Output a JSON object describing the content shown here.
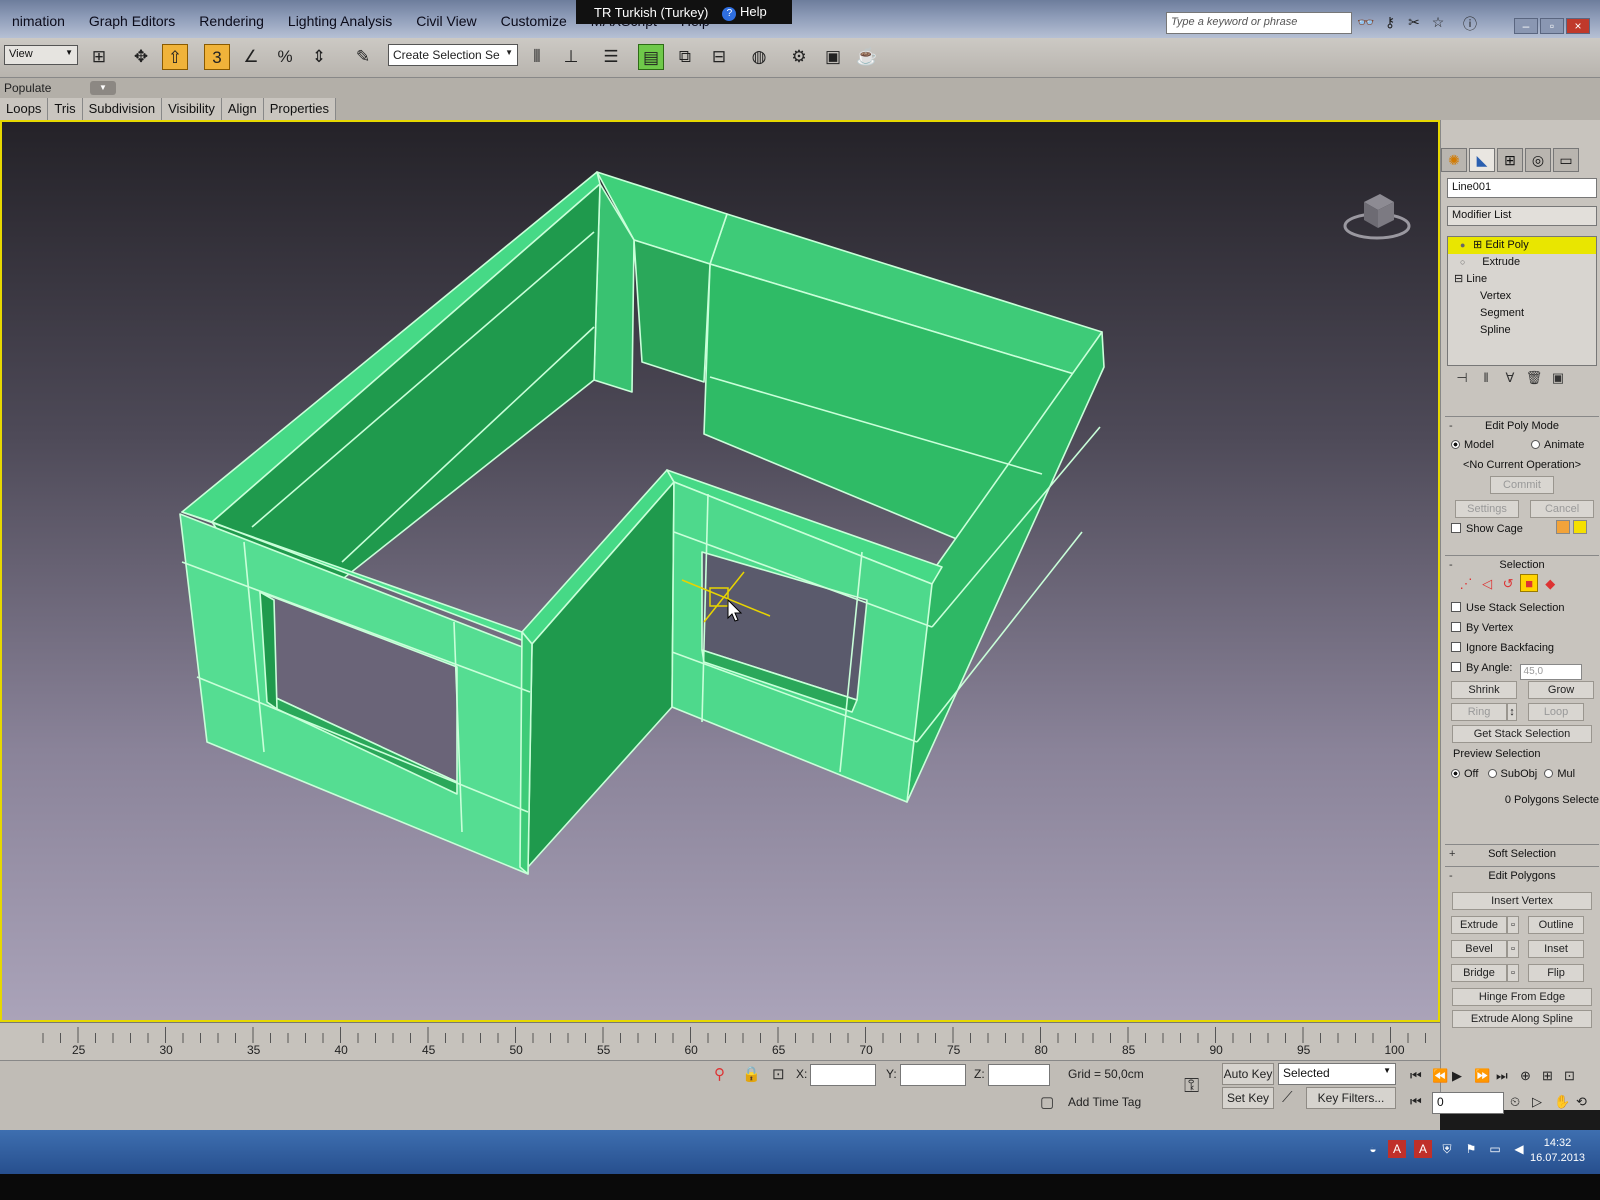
{
  "menu": {
    "items": [
      "nimation",
      "Graph Editors",
      "Rendering",
      "Lighting Analysis",
      "Civil View",
      "Customize",
      "MAXScript",
      "Help"
    ],
    "language_popup": "TR Turkish (Turkey)",
    "language_help": "Help",
    "search_placeholder": "Type a keyword or phrase"
  },
  "toolbar": {
    "view_dropdown": "View",
    "selection_set": "Create Selection Se",
    "snap_label": "3"
  },
  "ribbon": {
    "populate": "Populate",
    "tabs": [
      "Loops",
      "Tris",
      "Subdivision",
      "Visibility",
      "Align",
      "Properties"
    ]
  },
  "command_panel": {
    "object_name": "Line001",
    "modifier_list": "Modifier List",
    "stack": [
      "Edit Poly",
      "Extrude",
      "Line",
      "Vertex",
      "Segment",
      "Spline"
    ],
    "edit_poly_mode": {
      "title": "Edit Poly Mode",
      "model": "Model",
      "animate": "Animate",
      "operation": "<No Current Operation>",
      "commit": "Commit",
      "settings": "Settings",
      "cancel": "Cancel",
      "show_cage": "Show Cage"
    },
    "selection": {
      "title": "Selection",
      "use_stack": "Use Stack Selection",
      "by_vertex": "By Vertex",
      "ignore_backfacing": "Ignore Backfacing",
      "by_angle": "By Angle:",
      "angle_value": "45,0",
      "shrink": "Shrink",
      "grow": "Grow",
      "ring": "Ring",
      "loop": "Loop",
      "get_stack": "Get Stack Selection",
      "preview": "Preview Selection",
      "off": "Off",
      "subobj": "SubObj",
      "multi": "Mul",
      "status": "0 Polygons Selecte"
    },
    "soft_selection": "Soft Selection",
    "edit_polygons": {
      "title": "Edit Polygons",
      "insert_vertex": "Insert Vertex",
      "extrude": "Extrude",
      "outline": "Outline",
      "bevel": "Bevel",
      "inset": "Inset",
      "bridge": "Bridge",
      "flip": "Flip",
      "hinge": "Hinge From Edge",
      "extrude_spline": "Extrude Along Spline"
    }
  },
  "timeline": {
    "labels": [
      "25",
      "30",
      "35",
      "40",
      "45",
      "50",
      "55",
      "60",
      "65",
      "70",
      "75",
      "80",
      "85",
      "90",
      "95",
      "100"
    ]
  },
  "status": {
    "x_label": "X:",
    "y_label": "Y:",
    "z_label": "Z:",
    "grid": "Grid = 50,0cm",
    "add_time_tag": "Add Time Tag",
    "auto_key": "Auto Key",
    "set_key": "Set Key",
    "selected": "Selected",
    "key_filters": "Key Filters...",
    "frame": "0"
  },
  "taskbar": {
    "time": "14:32",
    "date": "16.07.2013"
  },
  "colors": {
    "model_green": "#3fd07a",
    "viewport_border": "#e6d800",
    "stack_highlight": "#e9e600"
  }
}
